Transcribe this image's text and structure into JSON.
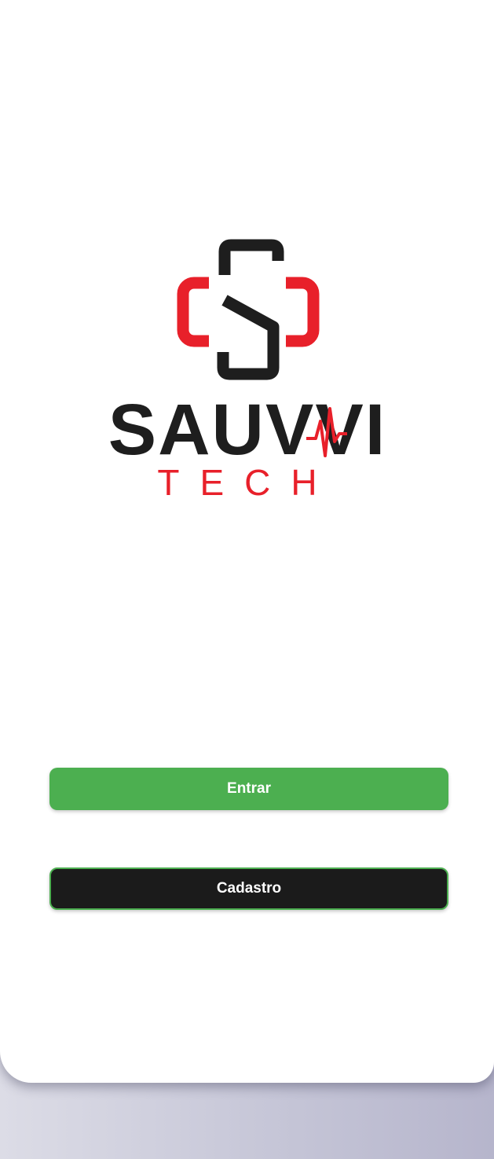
{
  "app": {
    "logo": {
      "wordmark": "SAUVVI",
      "tagline": "TECH",
      "icon": "medical-cross-s-icon"
    }
  },
  "actions": {
    "login_label": "Entrar",
    "signup_label": "Cadastro"
  },
  "colors": {
    "brand_red": "#e8202a",
    "brand_dark": "#1e1e1e",
    "accent_green": "#4caf50",
    "button_dark": "#1b1b1b",
    "background_white": "#ffffff"
  }
}
